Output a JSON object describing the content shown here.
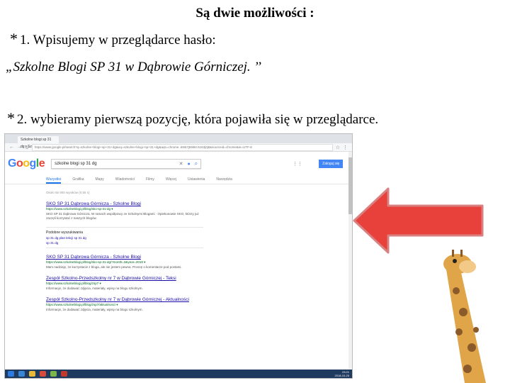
{
  "heading": "Są dwie możliwości :",
  "bullet_symbol": "*",
  "line1": "1. Wpisujemy w przeglądarce hasło:",
  "line2": "„Szkolne Blogi SP  31 w Dąbrowie Górniczej. ’’",
  "line3": "2. wybieramy pierwszą pozycję, która pojawiła się w przeglądarce.",
  "screenshot": {
    "tab_label": "Szkolne blogi sp 31 dg - Szuk...",
    "url": "https://www.google.pl/search?q=szkolne+blogi+sp+31+dg&oq=szkolne+blogi+sp+31+dg&aqs=chrome..69i57j69i60.5163j0j8&sourceid=chrome&ie=UTF-8",
    "logo_letters": [
      "G",
      "o",
      "o",
      "g",
      "l",
      "e"
    ],
    "search_query": "szkolne blogi sp 31 dg",
    "signin_label": "Zaloguj się",
    "tabs": [
      "Wszystko",
      "Grafika",
      "Mapy",
      "Wiadomości",
      "Filmy",
      "Więcej",
      "Ustawienia",
      "Narzędzia"
    ],
    "stats": "Około 56 900 wyników (0,55 s)",
    "results": [
      {
        "title": "SKO SP 31 Dąbrowa Górnicza - Szkolne Blogi",
        "url": "https://www.szkolneblogi.pl/blog/sko-sp-31-dg ▾",
        "desc": "SKO SP 31 Dąbrowa Górnicza. W ramach współpracy ze Szkolnymi Blogami · Opiekunowie SKO, którzy już zaczęli korzystać z naszych blogów."
      },
      {
        "title": "SKO SP 31 Dąbrowa Górnicza - Szkolne Blogi",
        "url": "https://www.szkolneblogi.pl/blog/sko-sp-31-dg/?month=3&year=2018 ▾",
        "desc": "Mam nadzieję, że korzystacie z bloga, ale nie jestem pewna. Proszę o komentarze pod postami."
      },
      {
        "title": "Zespół Szkolno-Przedszkolny nr 7 w Dąbrowie Górniczej - Teksi",
        "url": "https://www.szkolneblogi.pl/blog/zsp7 ▾",
        "desc": "Informacje, że dodawać zdjęcia, materiały, wpisy na blogu szkolnym."
      },
      {
        "title": "Zespół Szkolno-Przedszkolny nr 7 w Dąbrowie Górniczej - Aktualności",
        "url": "https://www.szkolneblogi.pl/blog/zsp7/aktualnosci ▾",
        "desc": "Informacje, że dodawać zdjęcia, materiały, wpisy na blogu szkolnym."
      }
    ],
    "related_heading": "Podobne wyszukiwania",
    "related": [
      "sp 31 dg plan lekcji    sp 31 dg",
      "sp 31 dg"
    ],
    "clock_time": "23:21",
    "clock_date": "2018-10-25"
  },
  "colors": {
    "arrow_fill": "#e8403a",
    "arrow_stroke": "#d98080",
    "giraffe": "#e0a548",
    "giraffe_spots": "#8b5a2b"
  }
}
